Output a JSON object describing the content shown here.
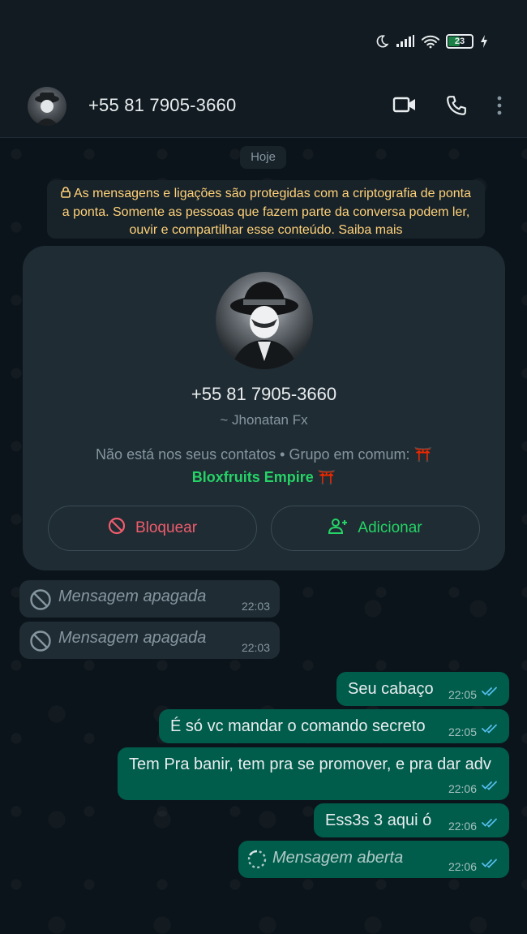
{
  "status_bar": {
    "battery_level": "23",
    "icons": [
      "moon-icon",
      "signal-icon",
      "wifi-icon",
      "battery-icon",
      "charging-icon"
    ]
  },
  "header": {
    "title": "+55 81 7905-3660",
    "actions": [
      "video-call-icon",
      "voice-call-icon",
      "more-vert-icon"
    ]
  },
  "chat": {
    "date_label": "Hoje",
    "encryption_notice": "As mensagens e ligações são protegidas com a criptografia de ponta a ponta. Somente as pessoas que fazem parte da conversa podem ler, ouvir e compartilhar esse conteúdo. Saiba mais",
    "contact_card": {
      "phone": "+55 81 7905-3660",
      "alias": "~ Jhonatan Fx",
      "info_text": "Não está nos seus contatos • Grupo em comum: ⛩️",
      "group_name": "Bloxfruits Empire ⛩️",
      "block_label": "Bloquear",
      "add_label": "Adicionar"
    },
    "messages": [
      {
        "direction": "in",
        "deleted": true,
        "text": "Mensagem apagada",
        "time": "22:03"
      },
      {
        "direction": "in",
        "deleted": true,
        "text": "Mensagem apagada",
        "time": "22:03"
      },
      {
        "direction": "out",
        "text": "Seu cabaço",
        "time": "22:05",
        "status": "read"
      },
      {
        "direction": "out",
        "text": "É só vc mandar o comando secreto",
        "time": "22:05",
        "status": "read"
      },
      {
        "direction": "out",
        "text": "Tem Pra banir, tem pra se promover, e pra dar adv",
        "time": "22:06",
        "status": "read"
      },
      {
        "direction": "out",
        "text": "Ess3s 3 aqui ó",
        "time": "22:06",
        "status": "read"
      },
      {
        "direction": "out",
        "view_once": true,
        "text": "Mensagem aberta",
        "time": "22:06",
        "status": "read"
      }
    ]
  },
  "colors": {
    "header_bg": "#111b21",
    "chat_bg": "#0b141a",
    "incoming_bubble": "#1f2c33",
    "outgoing_bubble": "#005c4b",
    "accent_green": "#25d366",
    "danger_red": "#f15c6d",
    "notice_yellow": "#ffd279",
    "read_tick_blue": "#53bdeb"
  }
}
